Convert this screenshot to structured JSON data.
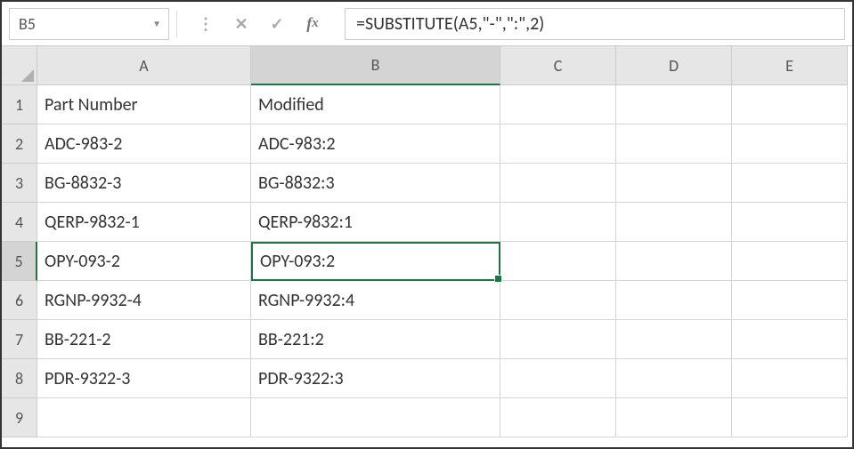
{
  "nameBox": "B5",
  "formula": "=SUBSTITUTE(A5,\"-\",\":\",2)",
  "columns": [
    "A",
    "B",
    "C",
    "D",
    "E"
  ],
  "activeCol": "B",
  "activeRow": 5,
  "rows": [
    {
      "n": 1,
      "A": "Part Number",
      "B": "Modified",
      "C": "",
      "D": "",
      "E": ""
    },
    {
      "n": 2,
      "A": "ADC-983-2",
      "B": "ADC-983:2",
      "C": "",
      "D": "",
      "E": ""
    },
    {
      "n": 3,
      "A": "BG-8832-3",
      "B": "BG-8832:3",
      "C": "",
      "D": "",
      "E": ""
    },
    {
      "n": 4,
      "A": "QERP-9832-1",
      "B": "QERP-9832:1",
      "C": "",
      "D": "",
      "E": ""
    },
    {
      "n": 5,
      "A": "OPY-093-2",
      "B": "OPY-093:2",
      "C": "",
      "D": "",
      "E": ""
    },
    {
      "n": 6,
      "A": "RGNP-9932-4",
      "B": "RGNP-9932:4",
      "C": "",
      "D": "",
      "E": ""
    },
    {
      "n": 7,
      "A": "BB-221-2",
      "B": "BB-221:2",
      "C": "",
      "D": "",
      "E": ""
    },
    {
      "n": 8,
      "A": "PDR-9322-3",
      "B": "PDR-9322:3",
      "C": "",
      "D": "",
      "E": ""
    },
    {
      "n": 9,
      "A": "",
      "B": "",
      "C": "",
      "D": "",
      "E": ""
    }
  ]
}
